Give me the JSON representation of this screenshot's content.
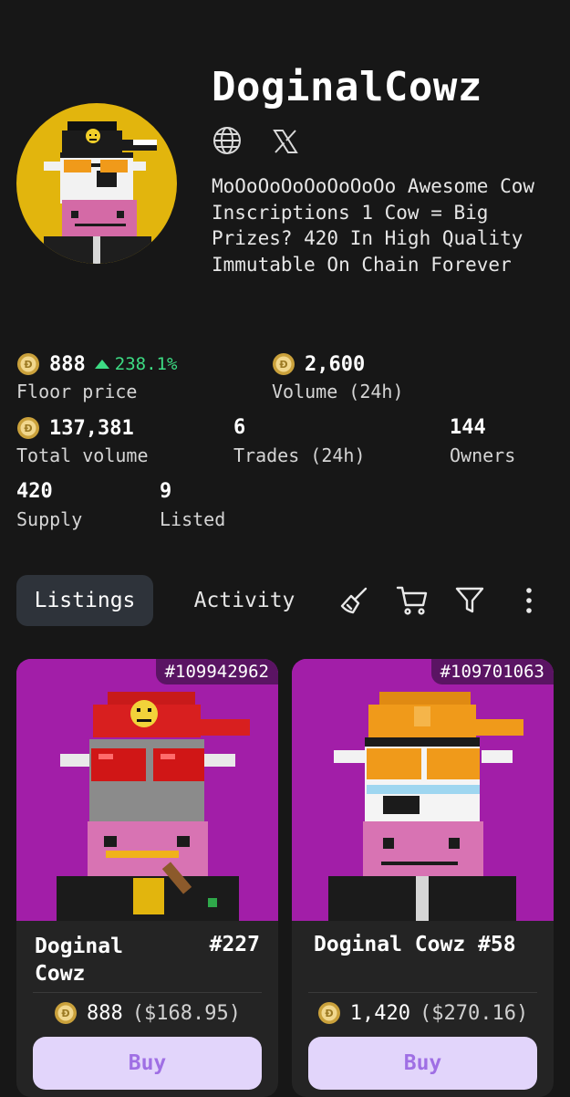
{
  "collection": {
    "name": "DoginalCowz",
    "description": "MoOoOoOoOoOoOoOo Awesome Cow Inscriptions 1 Cow = Big Prizes? 420 In High Quality Immutable On Chain Forever",
    "links": [
      {
        "icon": "globe-icon"
      },
      {
        "icon": "x-logo-icon"
      }
    ]
  },
  "stats": {
    "floor": {
      "value": "888",
      "change": "238.1%",
      "label": "Floor price",
      "change_color": "#3ddc84"
    },
    "volume24": {
      "value": "2,600",
      "label": "Volume (24h)"
    },
    "total_volume": {
      "value": "137,381",
      "label": "Total volume"
    },
    "trades24": {
      "value": "6",
      "label": "Trades (24h)"
    },
    "owners": {
      "value": "144",
      "label": "Owners"
    },
    "supply": {
      "value": "420",
      "label": "Supply"
    },
    "listed": {
      "value": "9",
      "label": "Listed"
    }
  },
  "tabs": [
    {
      "label": "Listings",
      "active": true
    },
    {
      "label": "Activity",
      "active": false
    }
  ],
  "toolbar": [
    "broom-icon",
    "cart-icon",
    "filter-icon",
    "more-vertical-icon"
  ],
  "listings": [
    {
      "id": "#109942962",
      "name": "Doginal Cowz",
      "number": "#227",
      "price": "888",
      "usd": "($168.95)",
      "buy": "Buy",
      "bg": "#a21ea8"
    },
    {
      "id": "#109701063",
      "name": "Doginal Cowz #58",
      "price": "1,420",
      "usd": "($270.16)",
      "buy": "Buy",
      "bg": "#a21ea8"
    }
  ],
  "colors": {
    "background": "#171717",
    "accent": "#e2d5fb",
    "buy_text": "#9f6fe4",
    "avatar_bg": "#e2b50d"
  }
}
